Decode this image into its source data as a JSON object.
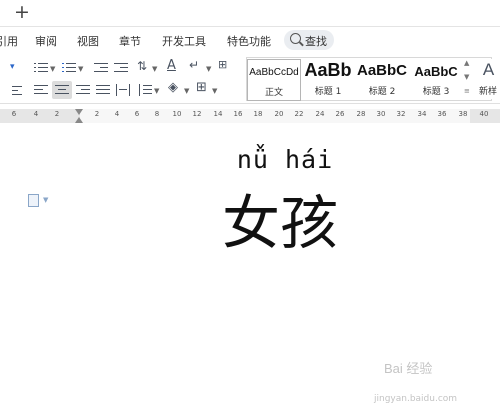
{
  "tabbar": {
    "new_tab_glyph": "+"
  },
  "menu": {
    "items": [
      "引用",
      "审阅",
      "视图",
      "章节",
      "开发工具",
      "特色功能"
    ],
    "search_label": "查找"
  },
  "styles": [
    {
      "sample": "AaBbCcDd",
      "name": "正文"
    },
    {
      "sample": "AaBb",
      "name": "标题 1"
    },
    {
      "sample": "AaBbC",
      "name": "标题 2"
    },
    {
      "sample": "AaBbC",
      "name": "标题 3"
    },
    {
      "sample": "A",
      "name": "新样"
    }
  ],
  "ruler": {
    "numbers": [
      "6",
      "4",
      "2",
      "2",
      "4",
      "6",
      "8",
      "10",
      "12",
      "14",
      "16",
      "18",
      "20",
      "22",
      "24",
      "26",
      "28",
      "30",
      "32",
      "34",
      "36",
      "38",
      "40"
    ]
  },
  "document": {
    "pinyin": "nǚ hái",
    "hanzi": "女孩"
  },
  "watermark": {
    "text": "Bai 经验",
    "sub": "jingyan.baidu.com"
  }
}
